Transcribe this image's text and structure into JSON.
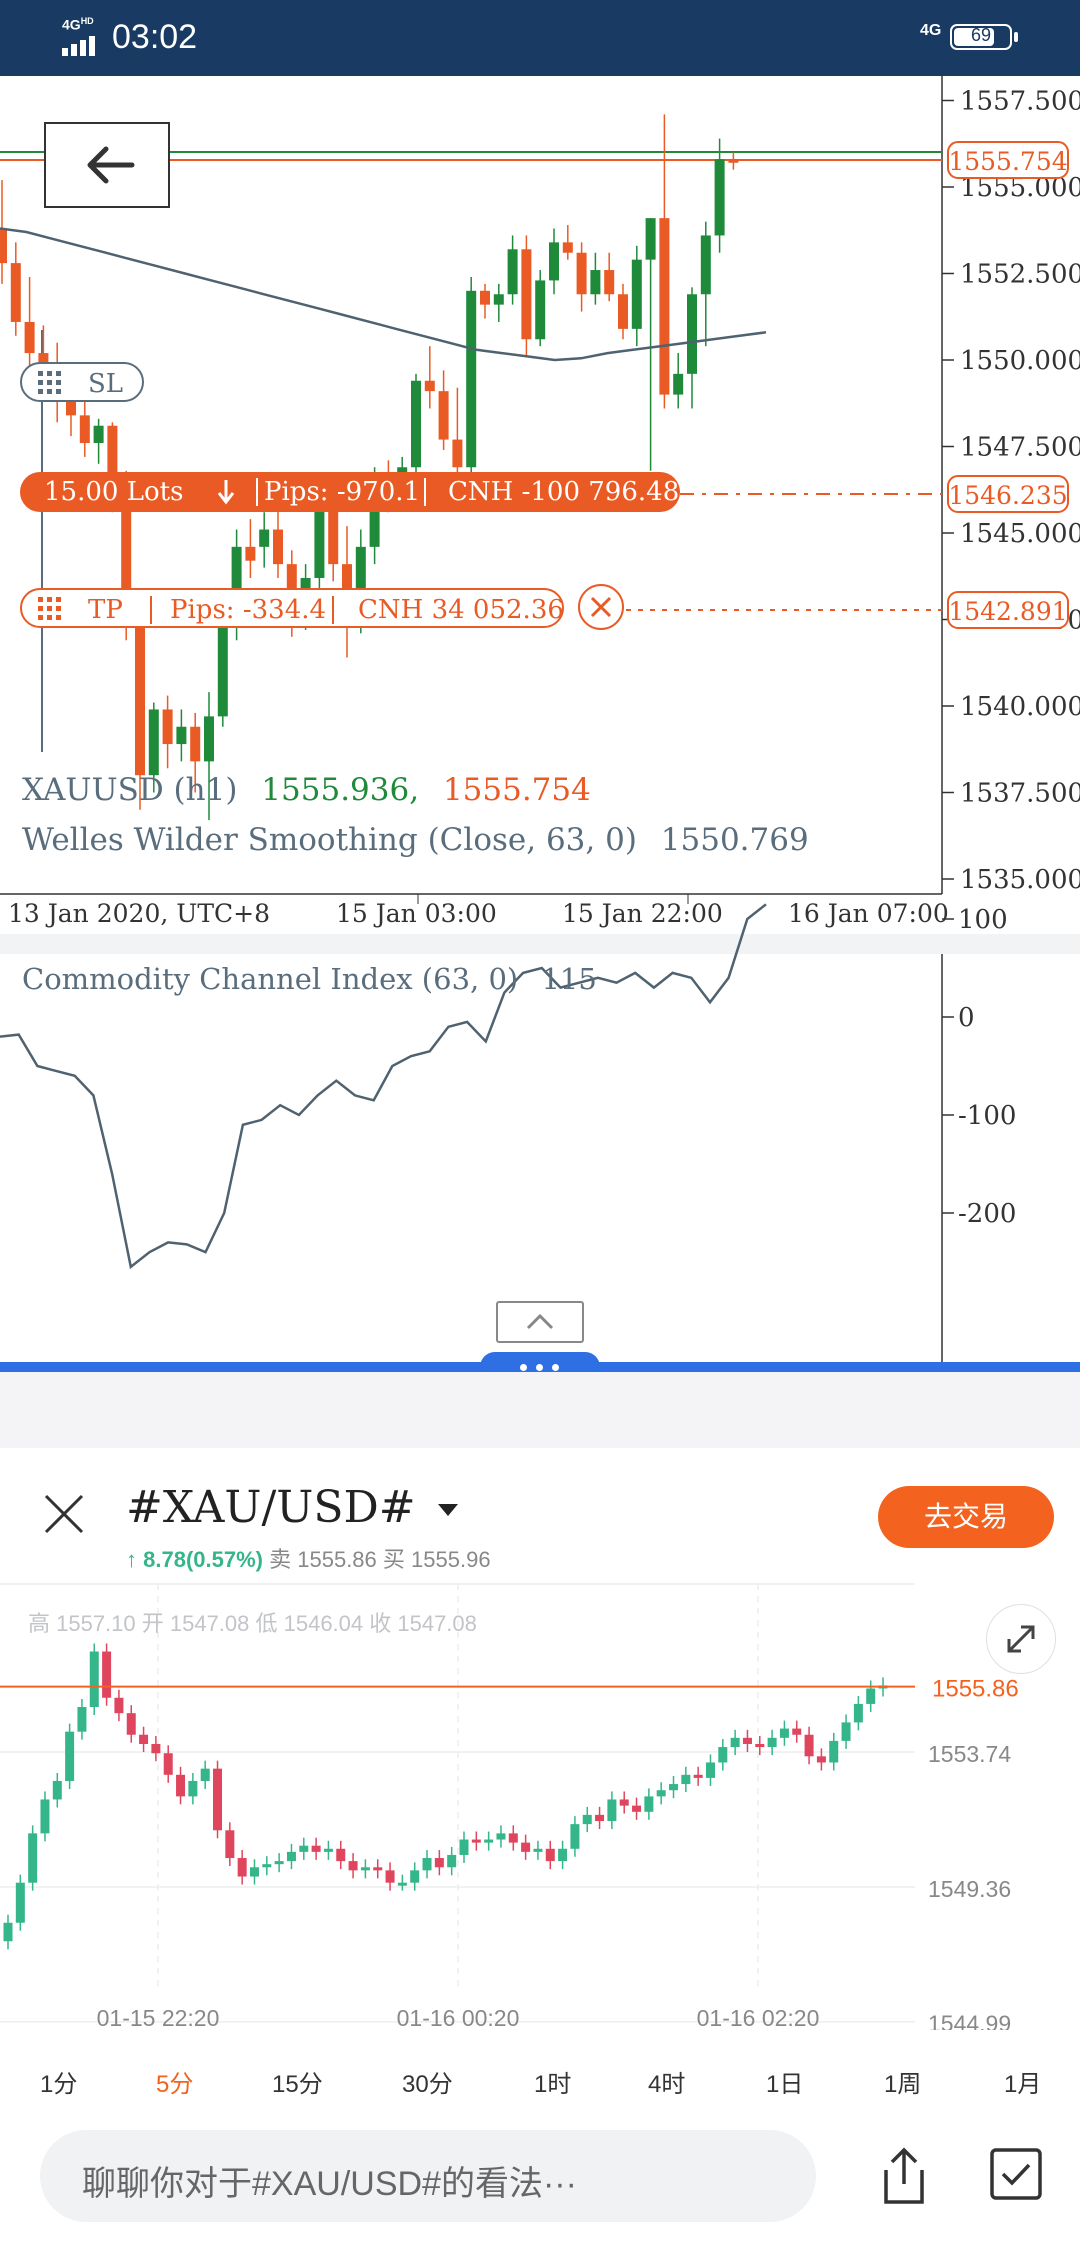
{
  "status_bar": {
    "network": "4G",
    "network_suffix": "HD",
    "time": "03:02",
    "network_right": "4G",
    "battery": "69"
  },
  "main_chart": {
    "price_axis": [
      "1557.500",
      "1555.000",
      "1552.500",
      "1550.000",
      "1547.500",
      "1545.000",
      "1542.500",
      "1540.000",
      "1537.500",
      "1535.000"
    ],
    "current_price_tag": "1555.754",
    "order_price_tag": "1546.235",
    "tp_price_tag": "1542.891",
    "time_axis": [
      "13 Jan 2020, UTC+8",
      "15 Jan 03:00",
      "15 Jan 22:00",
      "16 Jan 07:00"
    ],
    "sl_label": "SL",
    "order": {
      "lots": "15.00 Lots",
      "pips": "Pips: -970.1",
      "pnl": "CNH -100 796.48"
    },
    "tp": {
      "label": "TP",
      "pips": "Pips: -334.4",
      "pnl": "CNH 34 052.36"
    },
    "legend": {
      "symbol": "XAUUSD (h1)",
      "bid": "1555.936,",
      "ask": "1555.754",
      "indicator": "Welles Wilder Smoothing (Close, 63, 0)",
      "indicator_value": "1550.769"
    },
    "colors": {
      "up": "#1f8a3a",
      "down": "#ea5a24",
      "ma": "#4f6270"
    }
  },
  "cci_panel": {
    "label": "Commodity Channel Index (63, 0)",
    "value": "115",
    "axis": [
      "100",
      "0",
      "-100",
      "-200"
    ]
  },
  "quote_panel": {
    "symbol": "#XAU/USD#",
    "trade_button": "去交易",
    "change": "8.78(0.57%)",
    "sell_label": "卖",
    "sell_price": "1555.86",
    "buy_label": "买",
    "buy_price": "1555.96",
    "ohlc": "高 1557.10  开 1547.08  低 1546.04  收 1547.08",
    "current_price": "1555.86",
    "price_axis": [
      "1553.74",
      "1549.36",
      "1544.99"
    ],
    "time_axis": [
      "01-15 22:20",
      "01-16 00:20",
      "01-16 02:20"
    ],
    "timeframes": [
      "1分",
      "5分",
      "15分",
      "30分",
      "1时",
      "4时",
      "1日",
      "1周",
      "1月"
    ],
    "active_timeframe": "5分",
    "comment_placeholder": "聊聊你对于#XAU/USD#的看法···",
    "colors": {
      "up": "#34b58a",
      "down": "#e0455e",
      "accent": "#f4621f"
    }
  },
  "chart_data": [
    {
      "type": "candlestick",
      "title": "XAUUSD (h1)",
      "x": [
        "13 Jan 2020, UTC+8",
        "15 Jan 03:00",
        "15 Jan 22:00",
        "16 Jan 07:00"
      ],
      "ylim": [
        1535.0,
        1558.0
      ],
      "series": [
        {
          "name": "Welles Wilder Smoothing (Close, 63, 0)",
          "last": 1550.769
        },
        {
          "name": "XAUUSD (h1)",
          "last_bid": 1555.936,
          "last_ask": 1555.754
        }
      ],
      "ohlc": [
        [
          1553.8,
          1555.2,
          1552.2,
          1552.8
        ],
        [
          1552.8,
          1553.4,
          1550.7,
          1551.1
        ],
        [
          1551.1,
          1552.4,
          1549.5,
          1550.2
        ],
        [
          1550.2,
          1551.0,
          1549.4,
          1549.9
        ],
        [
          1549.9,
          1550.5,
          1548.2,
          1548.9
        ],
        [
          1548.9,
          1549.6,
          1547.8,
          1548.4
        ],
        [
          1548.4,
          1549.1,
          1547.2,
          1547.6
        ],
        [
          1547.6,
          1548.3,
          1547.0,
          1548.1
        ],
        [
          1548.1,
          1548.2,
          1545.6,
          1546.2
        ],
        [
          1546.2,
          1546.8,
          1541.9,
          1542.6
        ],
        [
          1542.6,
          1543.0,
          1537.0,
          1538.0
        ],
        [
          1538.0,
          1540.1,
          1537.5,
          1539.9
        ],
        [
          1539.9,
          1540.3,
          1538.2,
          1538.9
        ],
        [
          1538.9,
          1539.9,
          1538.4,
          1539.4
        ],
        [
          1539.4,
          1539.8,
          1537.5,
          1538.4
        ],
        [
          1538.4,
          1540.4,
          1536.7,
          1539.7
        ],
        [
          1539.7,
          1542.6,
          1539.4,
          1542.4
        ],
        [
          1542.4,
          1545.1,
          1541.9,
          1544.6
        ],
        [
          1544.6,
          1545.4,
          1543.7,
          1544.2
        ],
        [
          1544.6,
          1545.6,
          1544.0,
          1545.1
        ],
        [
          1545.1,
          1545.9,
          1543.7,
          1544.1
        ],
        [
          1544.1,
          1544.5,
          1542.0,
          1542.6
        ],
        [
          1542.6,
          1544.1,
          1542.2,
          1543.7
        ],
        [
          1543.7,
          1546.3,
          1543.2,
          1545.8
        ],
        [
          1545.8,
          1546.4,
          1543.6,
          1544.1
        ],
        [
          1544.1,
          1545.2,
          1541.4,
          1542.6
        ],
        [
          1542.6,
          1545.1,
          1542.1,
          1544.6
        ],
        [
          1544.6,
          1546.9,
          1544.1,
          1546.6
        ],
        [
          1546.6,
          1547.1,
          1545.6,
          1546.1
        ],
        [
          1546.1,
          1547.2,
          1545.7,
          1546.9
        ],
        [
          1546.9,
          1549.6,
          1546.4,
          1549.4
        ],
        [
          1549.4,
          1550.4,
          1548.6,
          1549.1
        ],
        [
          1549.1,
          1549.7,
          1547.4,
          1547.7
        ],
        [
          1547.7,
          1549.2,
          1546.2,
          1546.9
        ],
        [
          1546.9,
          1552.4,
          1546.4,
          1552.0
        ],
        [
          1552.0,
          1552.2,
          1551.2,
          1551.6
        ],
        [
          1551.6,
          1552.2,
          1551.1,
          1551.9
        ],
        [
          1551.9,
          1553.6,
          1551.6,
          1553.2
        ],
        [
          1553.2,
          1553.6,
          1550.1,
          1550.6
        ],
        [
          1550.6,
          1552.6,
          1550.4,
          1552.3
        ],
        [
          1552.3,
          1553.8,
          1551.9,
          1553.4
        ],
        [
          1553.4,
          1553.9,
          1552.9,
          1553.1
        ],
        [
          1553.1,
          1553.4,
          1551.4,
          1551.9
        ],
        [
          1551.9,
          1553.1,
          1551.6,
          1552.6
        ],
        [
          1552.6,
          1553.1,
          1551.7,
          1551.9
        ],
        [
          1551.9,
          1552.2,
          1550.6,
          1550.9
        ],
        [
          1550.9,
          1553.3,
          1550.4,
          1552.9
        ],
        [
          1552.9,
          1554.1,
          1546.8,
          1554.1
        ],
        [
          1554.1,
          1557.1,
          1548.6,
          1549.0
        ],
        [
          1549.0,
          1550.2,
          1548.6,
          1549.6
        ],
        [
          1549.6,
          1552.1,
          1548.6,
          1551.9
        ],
        [
          1551.9,
          1554.0,
          1550.4,
          1553.6
        ],
        [
          1553.6,
          1556.4,
          1553.1,
          1555.8
        ],
        [
          1555.8,
          1556.0,
          1555.5,
          1555.7
        ]
      ]
    },
    {
      "type": "line",
      "title": "Commodity Channel Index (63, 0)",
      "ylim": [
        -260,
        130
      ],
      "series": [
        {
          "name": "Commodity Channel Index (63, 0)",
          "values": [
            -20,
            -18,
            -50,
            -55,
            -60,
            -80,
            -160,
            -255,
            -240,
            -230,
            -232,
            -240,
            -200,
            -110,
            -105,
            -90,
            -100,
            -80,
            -65,
            -80,
            -85,
            -50,
            -40,
            -35,
            -10,
            -5,
            -25,
            25,
            45,
            50,
            30,
            35,
            40,
            35,
            45,
            30,
            45,
            40,
            15,
            40,
            100,
            115
          ]
        }
      ],
      "axis_ticks": [
        100,
        0,
        -100,
        -200
      ]
    },
    {
      "type": "candlestick",
      "title": "#XAU/USD#",
      "x": [
        "01-15 22:20",
        "01-16 00:20",
        "01-16 02:20"
      ],
      "ylim": [
        1544.0,
        1557.5
      ],
      "axis_ticks": [
        1553.74,
        1549.36,
        1544.99
      ],
      "last": 1555.86
    }
  ]
}
